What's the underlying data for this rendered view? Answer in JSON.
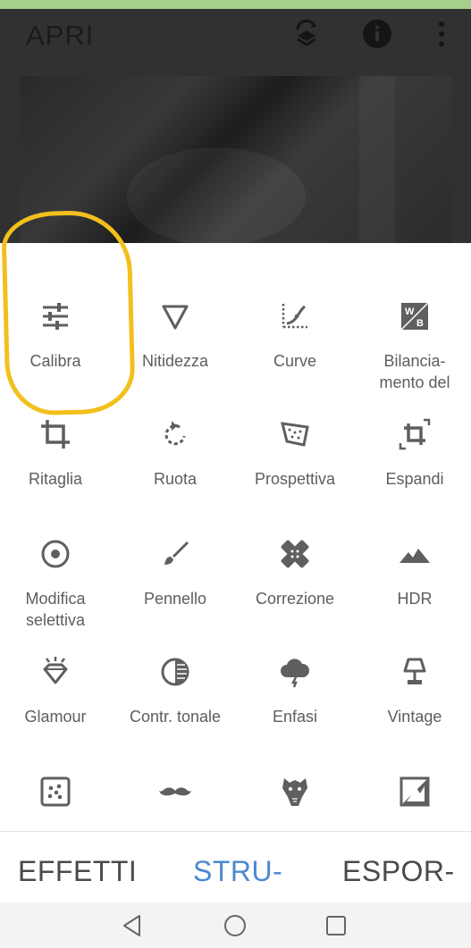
{
  "app_bar": {
    "open_label": "APRI",
    "icons": [
      "layers-undo-icon",
      "info-icon",
      "more-vert-icon"
    ]
  },
  "tools": [
    {
      "label": "Calibra",
      "icon": "tune-sliders-icon"
    },
    {
      "label": "Nitidezza",
      "icon": "sharpen-triangle-icon"
    },
    {
      "label": "Curve",
      "icon": "curves-icon"
    },
    {
      "label": "Bilancia-\nmento del",
      "icon": "white-balance-icon"
    },
    {
      "label": "Ritaglia",
      "icon": "crop-icon"
    },
    {
      "label": "Ruota",
      "icon": "rotate-icon"
    },
    {
      "label": "Prospettiva",
      "icon": "perspective-icon"
    },
    {
      "label": "Espandi",
      "icon": "expand-icon"
    },
    {
      "label": "Modifica\nselettiva",
      "icon": "selective-target-icon"
    },
    {
      "label": "Pennello",
      "icon": "brush-icon"
    },
    {
      "label": "Correzione",
      "icon": "healing-bandage-icon"
    },
    {
      "label": "HDR",
      "icon": "hdr-mountains-icon"
    },
    {
      "label": "Glamour",
      "icon": "glamour-diamond-icon"
    },
    {
      "label": "Contr. tonale",
      "icon": "tonal-contrast-icon"
    },
    {
      "label": "Enfasi",
      "icon": "drama-cloud-icon"
    },
    {
      "label": "Vintage",
      "icon": "vintage-lamp-icon"
    },
    {
      "label": "",
      "icon": "grainy-film-icon"
    },
    {
      "label": "",
      "icon": "mustache-icon"
    },
    {
      "label": "",
      "icon": "face-mask-icon"
    },
    {
      "label": "",
      "icon": "frame-icon"
    }
  ],
  "tabs": {
    "effects": "EFFETTI",
    "tools": "STRU-",
    "export": "ESPOR-"
  },
  "colors": {
    "accent": "#4a89d0",
    "highlight": "#f2c01c",
    "status_bar": "#a6cf8e"
  }
}
